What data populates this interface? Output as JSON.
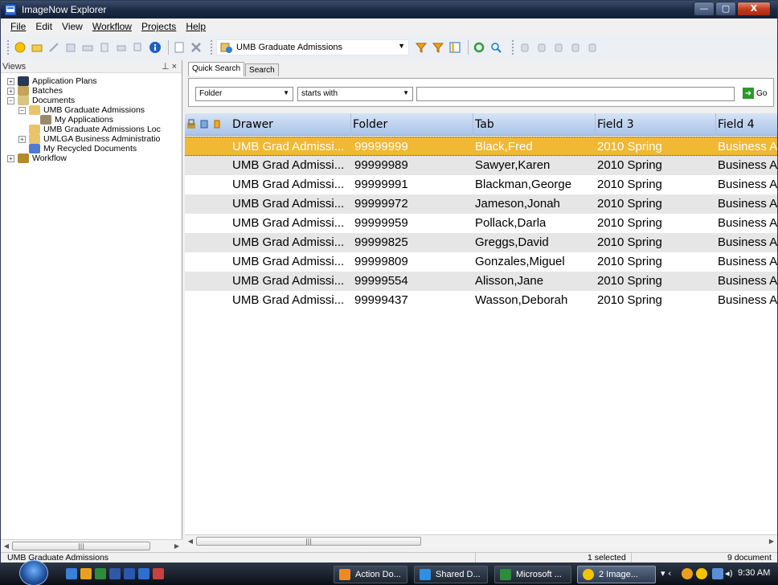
{
  "window": {
    "title": "ImageNow Explorer",
    "controls": {
      "minimize": "—",
      "maximize": "▢",
      "close": "X"
    }
  },
  "menu": [
    "File",
    "Edit",
    "View",
    "Workflow",
    "Projects",
    "Help"
  ],
  "toolbar": {
    "drawer_selected": "UMB Graduate Admissions"
  },
  "views": {
    "header": "Views",
    "pin": "⊥ ×",
    "tree": [
      {
        "label": "Application Plans",
        "icon": "binoculars-icon",
        "expander": "+",
        "level": 0
      },
      {
        "label": "Batches",
        "icon": "batch-icon",
        "expander": "+",
        "level": 0
      },
      {
        "label": "Documents",
        "icon": "documents-icon",
        "expander": "−",
        "level": 0
      },
      {
        "label": "UMB Graduate Admissions",
        "icon": "drawer-view-icon",
        "expander": "−",
        "level": 1
      },
      {
        "label": "My Applications",
        "icon": "filter-icon",
        "expander": "",
        "level": 2
      },
      {
        "label": "UMB Graduate Admissions Loc",
        "icon": "drawer-view-icon",
        "expander": "",
        "level": 1
      },
      {
        "label": "UMLGA Business Administratio",
        "icon": "drawer-view-icon",
        "expander": "+",
        "level": 1
      },
      {
        "label": "My Recycled Documents",
        "icon": "recycle-icon",
        "expander": "",
        "level": 1
      },
      {
        "label": "Workflow",
        "icon": "workflow-icon",
        "expander": "+",
        "level": 0
      }
    ]
  },
  "search": {
    "tabs": [
      "Quick Search",
      "Search"
    ],
    "field_select": "Folder",
    "operator_select": "starts with",
    "value": "",
    "go_label": "Go"
  },
  "grid": {
    "columns": [
      "Drawer",
      "Folder",
      "Tab",
      "Field 3",
      "Field 4"
    ],
    "rows": [
      {
        "drawer": "UMB Grad Admissi...",
        "folder": "99999999",
        "tab": "Black,Fred",
        "field3": "2010 Spring",
        "field4": "Business A",
        "selected": true
      },
      {
        "drawer": "UMB Grad Admissi...",
        "folder": "99999989",
        "tab": "Sawyer,Karen",
        "field3": "2010 Spring",
        "field4": "Business A"
      },
      {
        "drawer": "UMB Grad Admissi...",
        "folder": "99999991",
        "tab": "Blackman,George",
        "field3": "2010 Spring",
        "field4": "Business A"
      },
      {
        "drawer": "UMB Grad Admissi...",
        "folder": "99999972",
        "tab": "Jameson,Jonah",
        "field3": "2010 Spring",
        "field4": "Business A"
      },
      {
        "drawer": "UMB Grad Admissi...",
        "folder": "99999959",
        "tab": "Pollack,Darla",
        "field3": "2010 Spring",
        "field4": "Business A"
      },
      {
        "drawer": "UMB Grad Admissi...",
        "folder": "99999825",
        "tab": "Greggs,David",
        "field3": "2010 Spring",
        "field4": "Business A"
      },
      {
        "drawer": "UMB Grad Admissi...",
        "folder": "99999809",
        "tab": "Gonzales,Miguel",
        "field3": "2010 Spring",
        "field4": "Business A"
      },
      {
        "drawer": "UMB Grad Admissi...",
        "folder": "99999554",
        "tab": "Alisson,Jane",
        "field3": "2010 Spring",
        "field4": "Business A"
      },
      {
        "drawer": "UMB Grad Admissi...",
        "folder": "99999437",
        "tab": "Wasson,Deborah",
        "field3": "2010 Spring",
        "field4": "Business A"
      }
    ]
  },
  "status": {
    "view_name": "UMB Graduate Admissions",
    "selected": "1 selected",
    "count": "9 document"
  },
  "taskbar": {
    "buttons": [
      "Action Do...",
      "Shared D...",
      "Microsoft ...",
      "2 Image..."
    ],
    "clock": "9:30 AM"
  },
  "colors": {
    "selected_row": "#f0b833",
    "alt_row": "#e6e6e6",
    "header_grad_top": "#d6e3f6",
    "header_grad_bottom": "#aac4e8"
  }
}
